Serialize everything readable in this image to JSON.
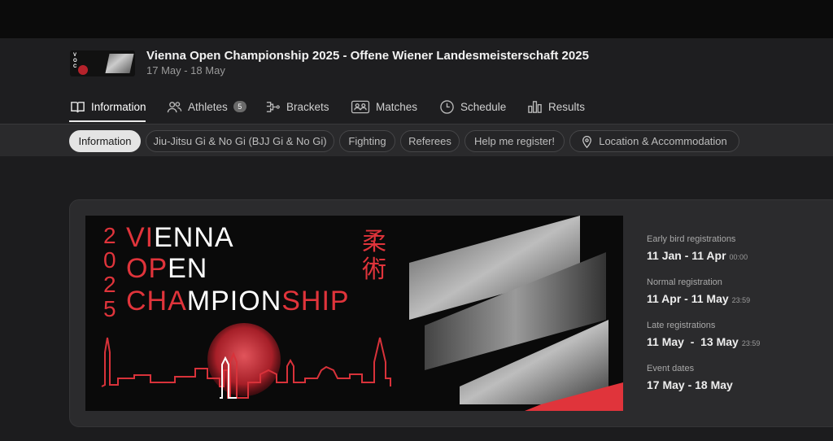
{
  "event": {
    "title": "Vienna Open Championship 2025 - Offene Wiener Landesmeisterschaft 2025",
    "dates": "17 May - 18 May",
    "logo_text": "VIENNA OPEN CHAMPIONSHIP"
  },
  "tabs": [
    {
      "label": "Information",
      "icon": "book-icon",
      "active": true
    },
    {
      "label": "Athletes",
      "icon": "people-icon",
      "badge": "5"
    },
    {
      "label": "Brackets",
      "icon": "brackets-icon"
    },
    {
      "label": "Matches",
      "icon": "matches-icon"
    },
    {
      "label": "Schedule",
      "icon": "clock-icon"
    },
    {
      "label": "Results",
      "icon": "bar-chart-icon"
    }
  ],
  "subtabs": [
    {
      "label": "Information",
      "active": true
    },
    {
      "label": "Jiu-Jitsu Gi & No Gi (BJJ Gi & No Gi)"
    },
    {
      "label": "Fighting"
    },
    {
      "label": "Referees"
    },
    {
      "label": "Help me register!"
    },
    {
      "label": "Location & Accommodation",
      "icon": "location-pin-icon"
    }
  ],
  "banner": {
    "year_digits": [
      "2",
      "0",
      "2",
      "5"
    ],
    "line1": [
      "VI",
      "ENNA"
    ],
    "line2": [
      "OP",
      "EN"
    ],
    "line3": [
      "CHA",
      "MPION",
      "SHIP"
    ],
    "kanji": [
      "柔",
      "術"
    ],
    "accent_color": "#e0343b"
  },
  "registrations": [
    {
      "label": "Early bird registrations",
      "value": "11 Jan - 11 Apr",
      "time": "00:00"
    },
    {
      "label": "Normal registration",
      "value": "11 Apr - 11 May",
      "time": "23:59"
    },
    {
      "label": "Late registrations",
      "value": "11 May  -  13 May",
      "time": "23:59"
    },
    {
      "label": "Event dates",
      "value": "17 May - 18 May",
      "time": ""
    }
  ]
}
